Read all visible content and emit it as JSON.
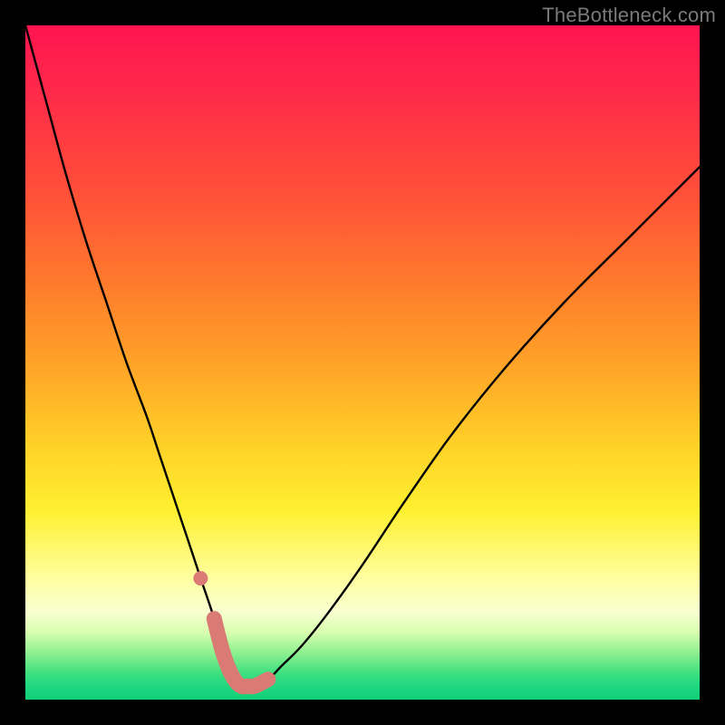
{
  "watermark": "TheBottleneck.com",
  "colors": {
    "background": "#000000",
    "curve": "#000000",
    "marker": "#d97a74",
    "gradient_top": "#ff1450",
    "gradient_bottom": "#10d078"
  },
  "chart_data": {
    "type": "line",
    "title": "",
    "xlabel": "",
    "ylabel": "",
    "xlim": [
      0,
      100
    ],
    "ylim": [
      0,
      100
    ],
    "grid": false,
    "legend": false,
    "annotations": [
      "TheBottleneck.com"
    ],
    "series": [
      {
        "name": "bottleneck-curve",
        "x": [
          0,
          3,
          6,
          9,
          12,
          15,
          18,
          20,
          22,
          24,
          26,
          28,
          29,
          30,
          31,
          32,
          33,
          34,
          36,
          38,
          41,
          45,
          50,
          56,
          63,
          71,
          80,
          90,
          100
        ],
        "values": [
          100,
          89,
          78,
          68,
          59,
          50,
          42,
          36,
          30,
          24,
          18,
          12,
          8,
          5,
          3,
          2,
          2,
          2,
          3,
          5,
          8,
          13,
          20,
          29,
          39,
          49,
          59,
          69,
          79
        ]
      },
      {
        "name": "bottleneck-marker",
        "x": [
          26,
          28,
          29,
          30,
          31,
          32,
          33,
          34,
          36
        ],
        "values": [
          18,
          12,
          8,
          5,
          3,
          2,
          2,
          2,
          3
        ]
      }
    ]
  }
}
